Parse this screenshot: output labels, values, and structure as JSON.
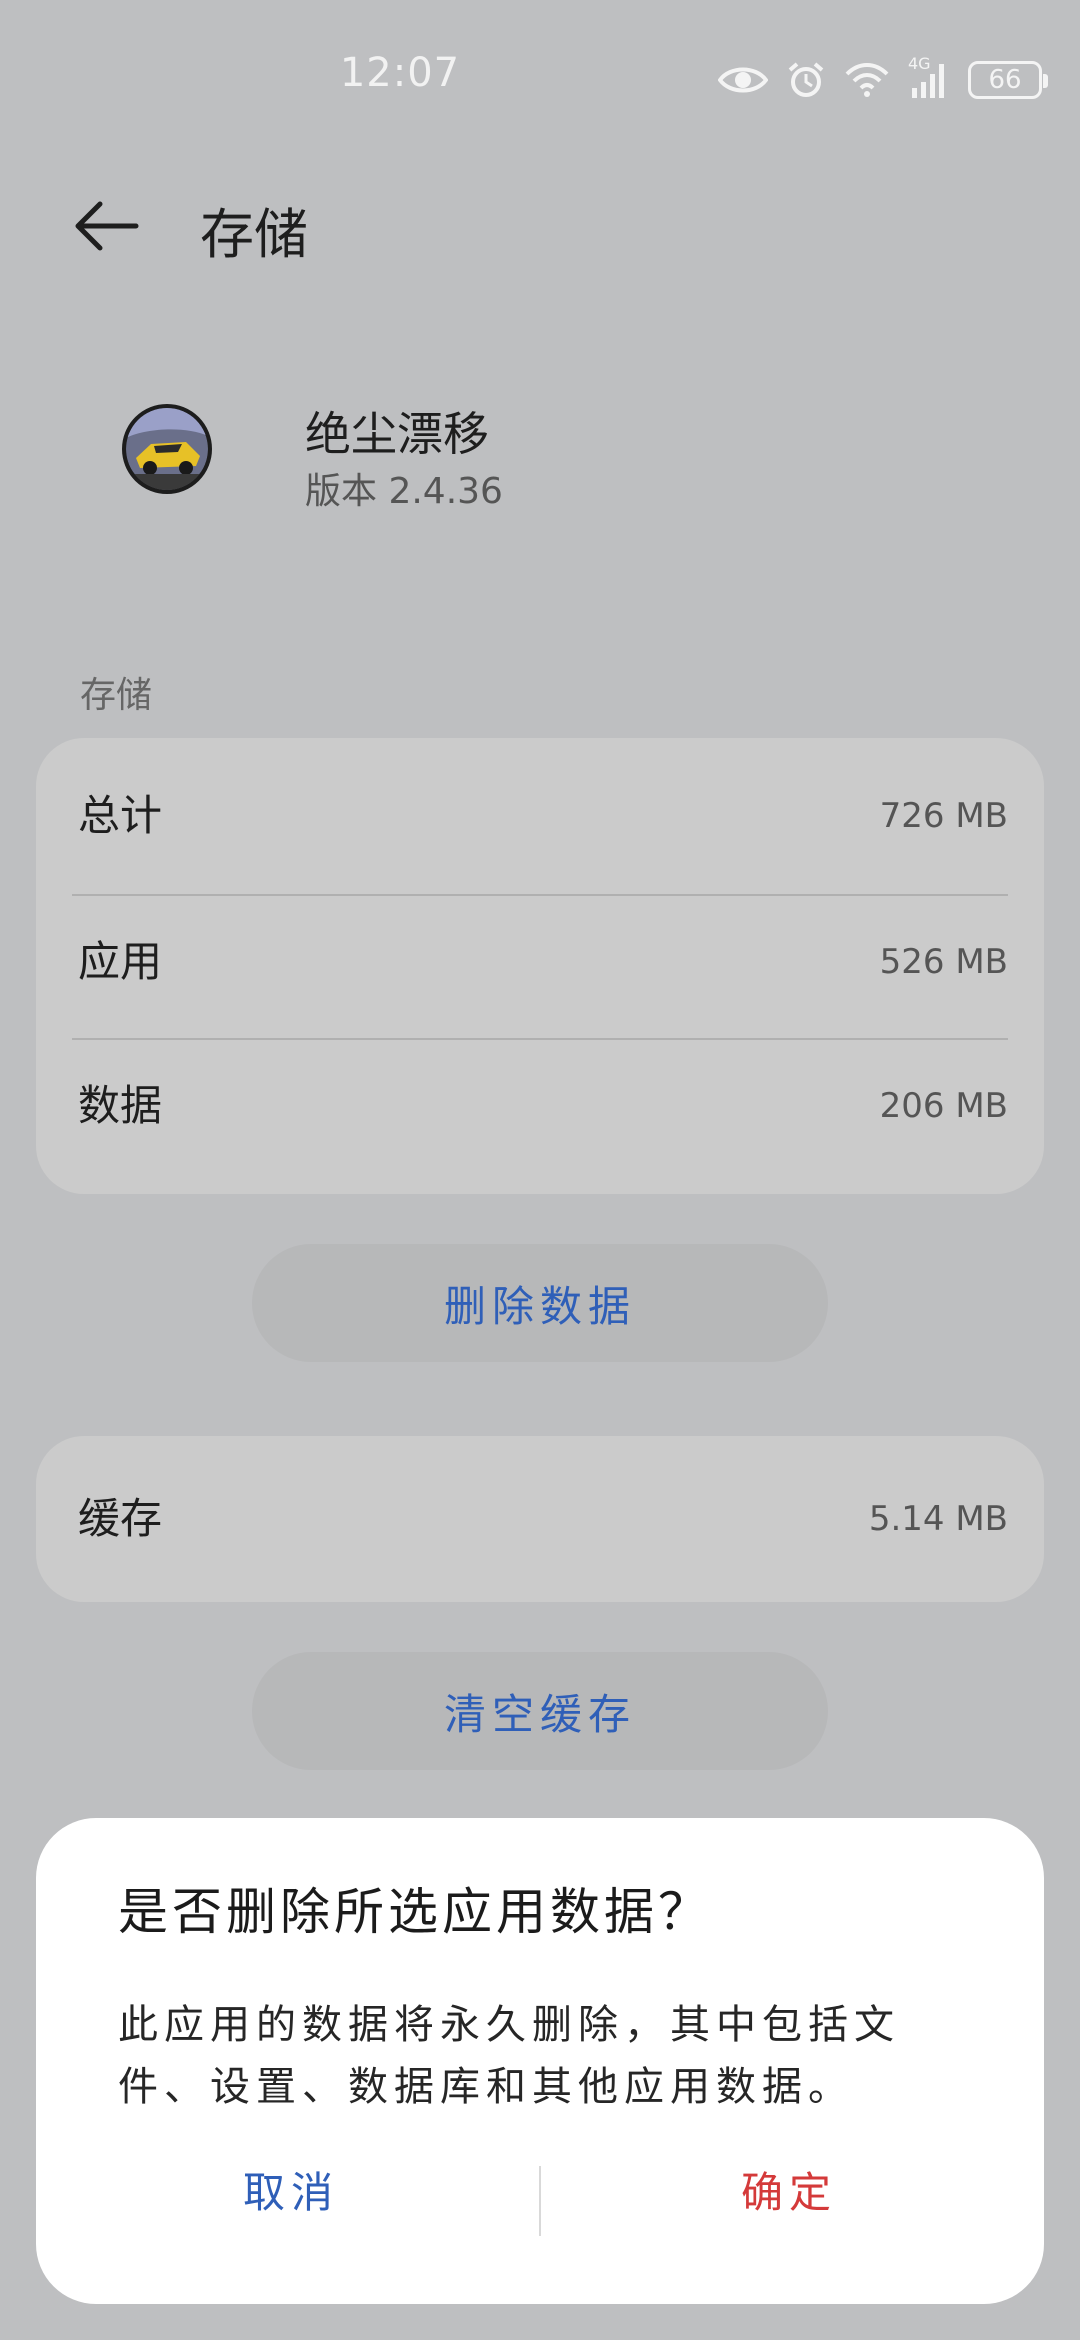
{
  "status_bar": {
    "time": "12:07",
    "network_label": "4G",
    "battery_level": "66",
    "icons": [
      "eye-icon",
      "alarm-icon",
      "wifi-icon",
      "signal-icon",
      "battery-icon"
    ]
  },
  "header": {
    "title": "存储"
  },
  "app": {
    "name": "绝尘漂移",
    "version": "版本 2.4.36"
  },
  "storage": {
    "section_label": "存储",
    "rows": [
      {
        "label": "总计",
        "value": "726 MB"
      },
      {
        "label": "应用",
        "value": "526 MB"
      },
      {
        "label": "数据",
        "value": "206 MB"
      }
    ],
    "delete_button": "删除数据"
  },
  "cache": {
    "label": "缓存",
    "value": "5.14 MB",
    "clear_button": "清空缓存"
  },
  "dialog": {
    "title": "是否删除所选应用数据？",
    "message": "此应用的数据将永久删除，其中包括文件、设置、数据库和其他应用数据。",
    "cancel": "取消",
    "confirm": "确定"
  },
  "colors": {
    "accent_blue": "#2f5fb8",
    "danger_red": "#d43a3a",
    "scrim_background": "#bebfc1"
  }
}
